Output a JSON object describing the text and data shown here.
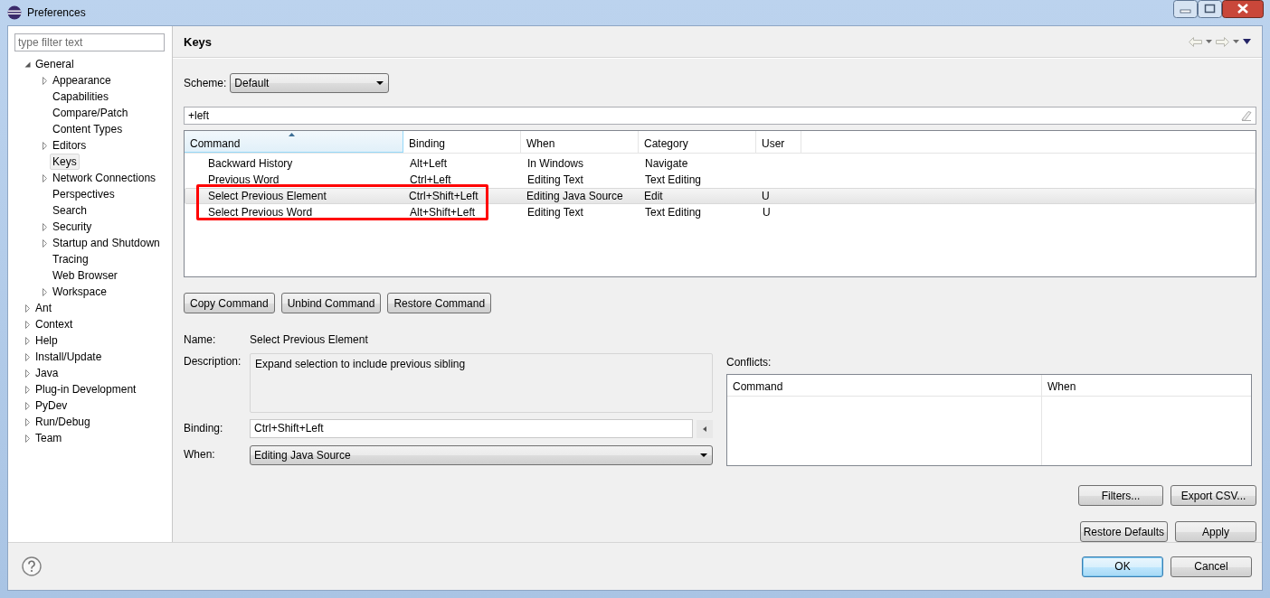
{
  "window": {
    "title": "Preferences"
  },
  "sidebar": {
    "filter": {
      "placeholder": "type filter text"
    },
    "tree": [
      {
        "label": "General",
        "expanded": true,
        "selected": false,
        "children": [
          {
            "label": "Appearance",
            "expanded": false,
            "selected": false
          },
          {
            "label": "Capabilities",
            "selected": false
          },
          {
            "label": "Compare/Patch",
            "selected": false
          },
          {
            "label": "Content Types",
            "selected": false
          },
          {
            "label": "Editors",
            "expanded": false,
            "selected": false
          },
          {
            "label": "Keys",
            "selected": true
          },
          {
            "label": "Network Connections",
            "expanded": false,
            "selected": false
          },
          {
            "label": "Perspectives",
            "selected": false
          },
          {
            "label": "Search",
            "selected": false
          },
          {
            "label": "Security",
            "expanded": false,
            "selected": false
          },
          {
            "label": "Startup and Shutdown",
            "expanded": false,
            "selected": false
          },
          {
            "label": "Tracing",
            "selected": false
          },
          {
            "label": "Web Browser",
            "selected": false
          },
          {
            "label": "Workspace",
            "expanded": false,
            "selected": false
          }
        ]
      },
      {
        "label": "Ant",
        "expanded": false,
        "selected": false
      },
      {
        "label": "Context",
        "expanded": false,
        "selected": false
      },
      {
        "label": "Help",
        "expanded": false,
        "selected": false
      },
      {
        "label": "Install/Update",
        "expanded": false,
        "selected": false
      },
      {
        "label": "Java",
        "expanded": false,
        "selected": false
      },
      {
        "label": "Plug-in Development",
        "expanded": false,
        "selected": false
      },
      {
        "label": "PyDev",
        "expanded": false,
        "selected": false
      },
      {
        "label": "Run/Debug",
        "expanded": false,
        "selected": false
      },
      {
        "label": "Team",
        "expanded": false,
        "selected": false
      }
    ]
  },
  "page": {
    "title": "Keys",
    "scheme": {
      "label": "Scheme:",
      "value": "Default"
    },
    "filter": {
      "value": "+left"
    },
    "table": {
      "columns": [
        {
          "label": "Command",
          "sorted": true
        },
        {
          "label": "Binding",
          "sorted": false
        },
        {
          "label": "When",
          "sorted": false
        },
        {
          "label": "Category",
          "sorted": false
        },
        {
          "label": "User",
          "sorted": false
        }
      ],
      "rows": [
        {
          "cells": [
            "Backward History",
            "Alt+Left",
            "In Windows",
            "Navigate",
            ""
          ],
          "selected": false
        },
        {
          "cells": [
            "Previous Word",
            "Ctrl+Left",
            "Editing Text",
            "Text Editing",
            ""
          ],
          "selected": false
        },
        {
          "cells": [
            "Select Previous Element",
            "Ctrl+Shift+Left",
            "Editing Java Source",
            "Edit",
            "U"
          ],
          "selected": true
        },
        {
          "cells": [
            "Select Previous Word",
            "Alt+Shift+Left",
            "Editing Text",
            "Text Editing",
            "U"
          ],
          "selected": false
        }
      ]
    },
    "buttons": [
      "Copy Command",
      "Unbind Command",
      "Restore Command"
    ],
    "details": {
      "name_label": "Name:",
      "name": "Select Previous Element",
      "description_label": "Description:",
      "description": "Expand selection to include previous sibling",
      "binding_label": "Binding:",
      "binding": "Ctrl+Shift+Left",
      "when_label": "When:",
      "when": "Editing Java Source"
    },
    "conflicts": {
      "label": "Conflicts:",
      "columns": [
        "Command",
        "When"
      ]
    },
    "side_buttons": [
      "Filters...",
      "Export CSV..."
    ],
    "page_buttons": [
      "Restore Defaults",
      "Apply"
    ]
  },
  "footer": {
    "buttons": [
      {
        "label": "OK",
        "default": true
      },
      {
        "label": "Cancel",
        "default": false
      }
    ]
  }
}
